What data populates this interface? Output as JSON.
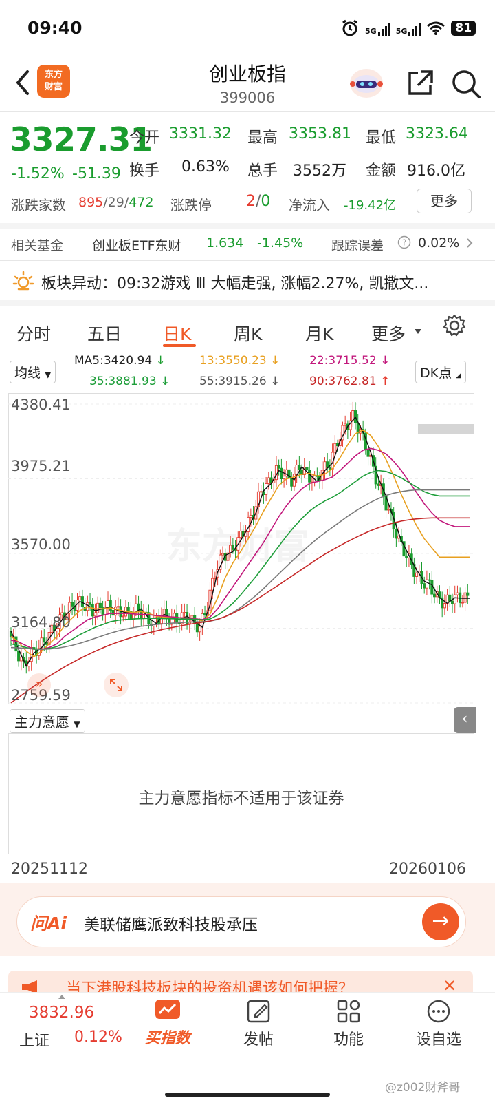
{
  "status_bar": {
    "time": "09:40",
    "signal1": "5G",
    "signal2": "5G",
    "battery": "81"
  },
  "header": {
    "title": "创业板指",
    "code": "399006",
    "logo_line1": "东方",
    "logo_line2": "财富"
  },
  "quote": {
    "price": "3327.31",
    "change_pct": "-1.52%",
    "change_abs": "-51.39",
    "open_label": "今开",
    "open": "3331.32",
    "high_label": "最高",
    "high": "3353.81",
    "low_label": "最低",
    "low": "3323.64",
    "turnover_label": "换手",
    "turnover": "0.63%",
    "volume_label": "总手",
    "volume": "3552万",
    "amount_label": "金额",
    "amount": "916.0亿",
    "breadth_label": "涨跌家数",
    "breadth_up": "895",
    "breadth_flat": "29",
    "breadth_down": "472",
    "breadth_sep": "/",
    "limit_label": "涨跌停",
    "limit_up": "2",
    "limit_down": "0",
    "netflow_label": "净流入",
    "netflow": "-19.42亿",
    "more_label": "更多"
  },
  "funds": {
    "label": "相关基金",
    "name": "创业板ETF东财",
    "price": "1.634",
    "change": "-1.45%",
    "tracking_label": "跟踪误差",
    "tracking": "0.02%"
  },
  "news": {
    "text": "板块异动：09:32游戏 Ⅲ 大幅走强, 涨幅2.27%, 凯撒文..."
  },
  "tabs": [
    "分时",
    "五日",
    "日K",
    "周K",
    "月K",
    "更多"
  ],
  "ma": {
    "selector": "均线",
    "ma5": "MA5:3420.94",
    "ma13": "13:3550.23",
    "ma22": "22:3715.52",
    "ma35": "35:3881.93",
    "ma55": "55:3915.26",
    "ma90": "90:3762.81",
    "down_arrow": "↓",
    "up_arrow": "↑",
    "dk_label": "DK点"
  },
  "chart_axis": {
    "y1": "4380.41",
    "y2": "3975.21",
    "y3": "3570.00",
    "y4": "3164.80",
    "y5": "2759.59"
  },
  "chart_data": {
    "type": "line",
    "ylim": [
      2759.59,
      4380.41
    ],
    "yticks": [
      4380.41,
      3975.21,
      3570.0,
      3164.8,
      2759.59
    ],
    "x": [
      0,
      1,
      2,
      3,
      4,
      5,
      6,
      7,
      8,
      9,
      10,
      11,
      12,
      13,
      14,
      15,
      16,
      17,
      18,
      19,
      20,
      21,
      22,
      23,
      24,
      25,
      26,
      27,
      28,
      29,
      30,
      31,
      32,
      33,
      34,
      35,
      36,
      37,
      38,
      39,
      40,
      41,
      42,
      43,
      44,
      45,
      46,
      47,
      48,
      49,
      50,
      51,
      52,
      53,
      54,
      55,
      56,
      57,
      58,
      59,
      60
    ],
    "series": [
      {
        "color": "#111111",
        "values": [
          3150,
          3050,
          2960,
          3030,
          3060,
          3110,
          3170,
          3230,
          3270,
          3310,
          3290,
          3260,
          3270,
          3280,
          3260,
          3250,
          3245,
          3270,
          3220,
          3190,
          3240,
          3220,
          3210,
          3230,
          3200,
          3170,
          3290,
          3470,
          3560,
          3580,
          3640,
          3710,
          3790,
          3910,
          3950,
          4020,
          4000,
          3970,
          4040,
          4000,
          3960,
          4020,
          4060,
          4180,
          4260,
          4310,
          4230,
          4120,
          3980,
          3880,
          3760,
          3640,
          3560,
          3480,
          3420,
          3400,
          3330,
          3300,
          3330,
          3327,
          3327
        ]
      },
      {
        "color": "#e8a020",
        "values": [
          3120,
          3090,
          3040,
          3010,
          3040,
          3080,
          3120,
          3180,
          3220,
          3260,
          3280,
          3270,
          3270,
          3275,
          3265,
          3255,
          3250,
          3255,
          3245,
          3230,
          3225,
          3225,
          3222,
          3220,
          3215,
          3205,
          3240,
          3330,
          3440,
          3520,
          3580,
          3650,
          3720,
          3800,
          3870,
          3940,
          3975,
          3985,
          4000,
          4005,
          3990,
          4000,
          4030,
          4090,
          4160,
          4220,
          4240,
          4210,
          4150,
          4080,
          3990,
          3890,
          3800,
          3720,
          3650,
          3600,
          3550,
          3550,
          3550,
          3550,
          3550
        ]
      },
      {
        "color": "#c2187c",
        "values": [
          3100,
          3090,
          3070,
          3050,
          3050,
          3060,
          3080,
          3120,
          3150,
          3180,
          3210,
          3225,
          3235,
          3245,
          3245,
          3245,
          3242,
          3240,
          3238,
          3233,
          3230,
          3226,
          3222,
          3220,
          3216,
          3212,
          3225,
          3270,
          3330,
          3390,
          3450,
          3510,
          3570,
          3630,
          3700,
          3770,
          3830,
          3880,
          3920,
          3950,
          3960,
          3970,
          3985,
          4020,
          4060,
          4100,
          4130,
          4140,
          4130,
          4110,
          4070,
          4020,
          3960,
          3900,
          3840,
          3790,
          3750,
          3730,
          3716,
          3716,
          3716
        ]
      },
      {
        "color": "#1e9e3a",
        "values": [
          3080,
          3070,
          3060,
          3050,
          3050,
          3055,
          3065,
          3085,
          3105,
          3130,
          3150,
          3170,
          3185,
          3200,
          3208,
          3212,
          3215,
          3217,
          3218,
          3218,
          3217,
          3216,
          3215,
          3214,
          3213,
          3210,
          3215,
          3235,
          3265,
          3300,
          3345,
          3395,
          3445,
          3500,
          3555,
          3610,
          3665,
          3715,
          3760,
          3800,
          3830,
          3855,
          3875,
          3900,
          3930,
          3960,
          3990,
          4010,
          4020,
          4015,
          4000,
          3980,
          3955,
          3930,
          3905,
          3890,
          3882,
          3882,
          3882,
          3882,
          3882
        ]
      },
      {
        "color": "#7a7a7a",
        "values": [
          3060,
          3058,
          3055,
          3052,
          3050,
          3052,
          3056,
          3063,
          3072,
          3083,
          3096,
          3110,
          3124,
          3138,
          3150,
          3160,
          3168,
          3175,
          3180,
          3185,
          3189,
          3192,
          3195,
          3197,
          3199,
          3200,
          3203,
          3212,
          3228,
          3250,
          3277,
          3308,
          3342,
          3380,
          3420,
          3460,
          3500,
          3540,
          3578,
          3615,
          3650,
          3682,
          3712,
          3742,
          3772,
          3800,
          3825,
          3848,
          3868,
          3885,
          3897,
          3906,
          3912,
          3915,
          3915,
          3915,
          3915,
          3915,
          3915,
          3915,
          3915
        ]
      },
      {
        "color": "#c62828",
        "values": [
          2760,
          2790,
          2820,
          2850,
          2878,
          2905,
          2930,
          2955,
          2978,
          3000,
          3020,
          3040,
          3058,
          3075,
          3090,
          3104,
          3117,
          3129,
          3140,
          3150,
          3160,
          3168,
          3176,
          3184,
          3191,
          3197,
          3204,
          3214,
          3228,
          3246,
          3268,
          3292,
          3318,
          3345,
          3373,
          3400,
          3428,
          3456,
          3484,
          3512,
          3540,
          3566,
          3590,
          3613,
          3635,
          3656,
          3676,
          3694,
          3710,
          3724,
          3736,
          3746,
          3753,
          3758,
          3761,
          3763,
          3763,
          3763,
          3763,
          3763,
          3763
        ]
      }
    ]
  },
  "chart_overlay": {
    "watermark": "东方财富"
  },
  "indicator": {
    "selector": "主力意愿",
    "message": "主力意愿指标不适用于该证券",
    "date_left": "20251112",
    "date_right": "20260106"
  },
  "ai": {
    "logo": "问Ai",
    "text": "美联储鹰派致科技股承压"
  },
  "promo": {
    "text": "当下港股科技板块的投资机遇该如何把握？",
    "close": "✕"
  },
  "bottom_nav": {
    "index_price": "3832.96",
    "index_name": "上证",
    "index_change": "0.12%",
    "items": [
      "买指数",
      "发帖",
      "功能",
      "设自选"
    ]
  },
  "watermark": "@z002财斧哥"
}
